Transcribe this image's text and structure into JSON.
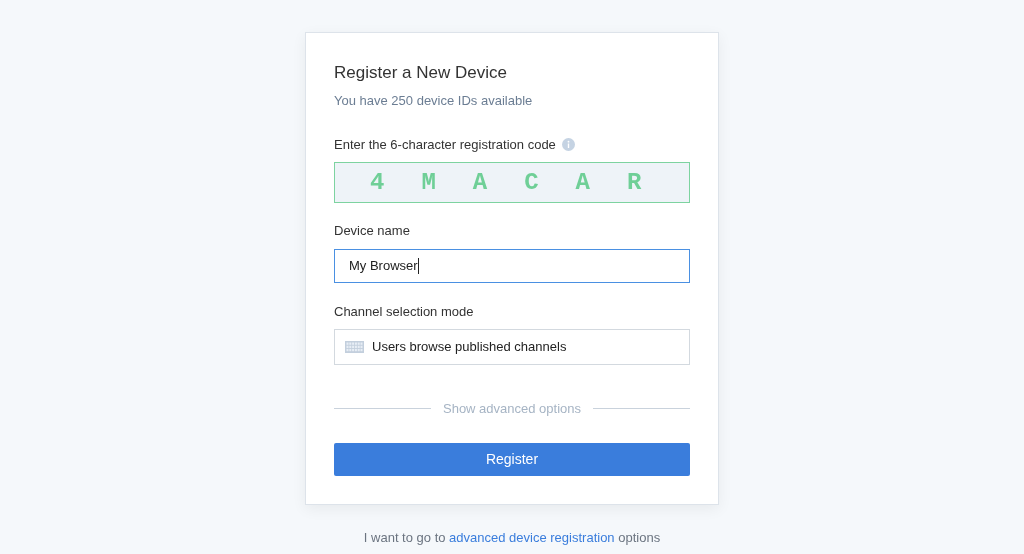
{
  "card": {
    "title": "Register a New Device",
    "subtitle": "You have 250 device IDs available"
  },
  "code_field": {
    "label": "Enter the 6-character registration code",
    "value": "4MACAR",
    "valid": true
  },
  "name_field": {
    "label": "Device name",
    "value": "My Browser",
    "focused": true
  },
  "channel_mode": {
    "label": "Channel selection mode",
    "value": "Users browse published channels"
  },
  "advanced_toggle": "Show advanced options",
  "register_button": "Register",
  "footer": {
    "before": "I want to go to ",
    "link": "advanced device registration",
    "after": " options"
  }
}
